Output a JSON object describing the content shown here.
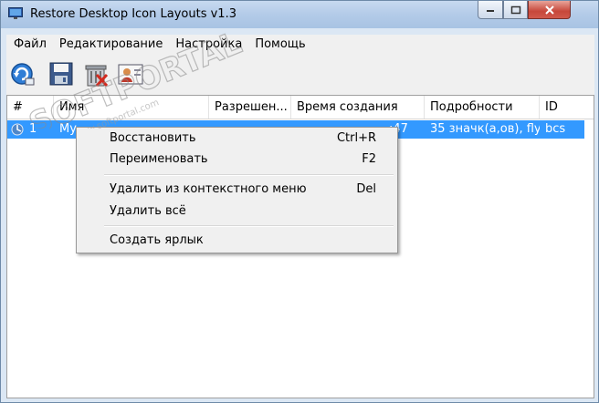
{
  "window": {
    "title": "Restore Desktop Icon Layouts v1.3"
  },
  "menubar": {
    "items": [
      "Файл",
      "Редактирование",
      "Настройка",
      "Помощь"
    ]
  },
  "toolbar": {
    "buttons": [
      "restore-layout-icon",
      "save-layout-icon",
      "delete-icon",
      "shortcut-icon"
    ]
  },
  "listview": {
    "columns": [
      "#",
      "Имя",
      "Разрешен...",
      "Время создания",
      "Подробности",
      "ID"
    ],
    "rows": [
      {
        "num": "1",
        "name": "My",
        "time": ":47",
        "details": "35 значк(а,ов), fly",
        "id": "bcs",
        "selected": true
      }
    ]
  },
  "context_menu": {
    "restore": {
      "label": "Восстановить",
      "key": "Ctrl+R"
    },
    "rename": {
      "label": "Переименовать",
      "key": "F2"
    },
    "remove_ctx": {
      "label": "Удалить из контекстного меню",
      "key": "Del"
    },
    "delete_all": {
      "label": "Удалить всё"
    },
    "create_shortcut": {
      "label": "Создать ярлык"
    }
  },
  "watermark": {
    "text": "SOFTPORTAL",
    "url": "www.softportal.com"
  },
  "colors": {
    "selection": "#3399ff",
    "titlebar": "#b3cbe8",
    "close": "#c7473a"
  }
}
